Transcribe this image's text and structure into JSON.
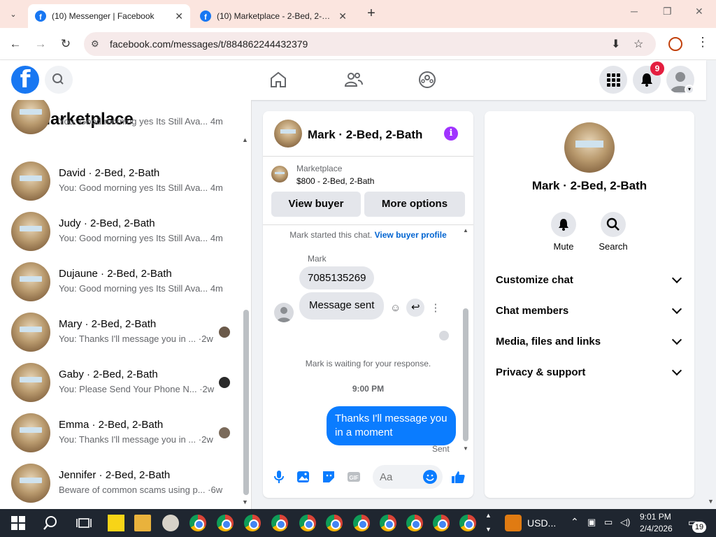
{
  "browser": {
    "tabs": [
      {
        "title": "(10) Messenger | Facebook",
        "active": true
      },
      {
        "title": "(10) Marketplace - 2-Bed, 2-Bat",
        "active": false
      }
    ],
    "new_tab": "+",
    "url": "facebook.com/messages/t/884862244432379"
  },
  "fb_header": {
    "notifications_count": "9"
  },
  "left": {
    "title": "Marketplace",
    "partial": {
      "preview": "You: Good morning yes Its Still Ava...",
      "time": "4m"
    },
    "conversations": [
      {
        "name": "David · 2-Bed, 2-Bath",
        "preview": "You: Good morning yes Its Still Ava...",
        "time": "4m"
      },
      {
        "name": "Judy · 2-Bed, 2-Bath",
        "preview": "You: Good morning yes Its Still Ava...",
        "time": "4m"
      },
      {
        "name": "Dujaune · 2-Bed, 2-Bath",
        "preview": "You: Good morning yes Its Still Ava...",
        "time": "4m"
      },
      {
        "name": "Mary · 2-Bed, 2-Bath",
        "preview": "You: Thanks I'll message you in ...",
        "time": "·2w"
      },
      {
        "name": "Gaby · 2-Bed, 2-Bath",
        "preview": "You: Please Send Your Phone N...",
        "time": "·2w"
      },
      {
        "name": "Emma · 2-Bed, 2-Bath",
        "preview": "You: Thanks I'll message you in ...",
        "time": "·2w"
      },
      {
        "name": "Jennifer · 2-Bed, 2-Bath",
        "preview": "Beware of common scams using p...",
        "time": "·6w"
      }
    ]
  },
  "chat": {
    "title": "Mark · 2-Bed, 2-Bath",
    "marketplace_label": "Marketplace",
    "listing": "$800 - 2-Bed, 2-Bath",
    "view_buyer": "View buyer",
    "more_options": "More options",
    "started_text": "Mark started this chat.",
    "view_buyer_profile": "View buyer profile",
    "sender": "Mark",
    "incoming": [
      "7085135269",
      "Message sent"
    ],
    "waiting": "Mark is waiting for your response.",
    "time": "9:00 PM",
    "outgoing": "Thanks I'll message you in a moment",
    "sent": "Sent",
    "composer_placeholder": "Aa"
  },
  "info": {
    "name": "Mark · 2-Bed, 2-Bath",
    "mute": "Mute",
    "search": "Search",
    "menu": [
      "Customize chat",
      "Chat members",
      "Media, files and links",
      "Privacy & support"
    ]
  },
  "taskbar": {
    "currency": "USD...",
    "time": "9:01 PM",
    "date": "2/4/2026",
    "notif_count": "19"
  },
  "colors": {
    "fb_blue": "#1877f2",
    "outgoing_bubble": "#0a7cff",
    "info_purple": "#a033ff",
    "badge_red": "#e41e3f"
  }
}
